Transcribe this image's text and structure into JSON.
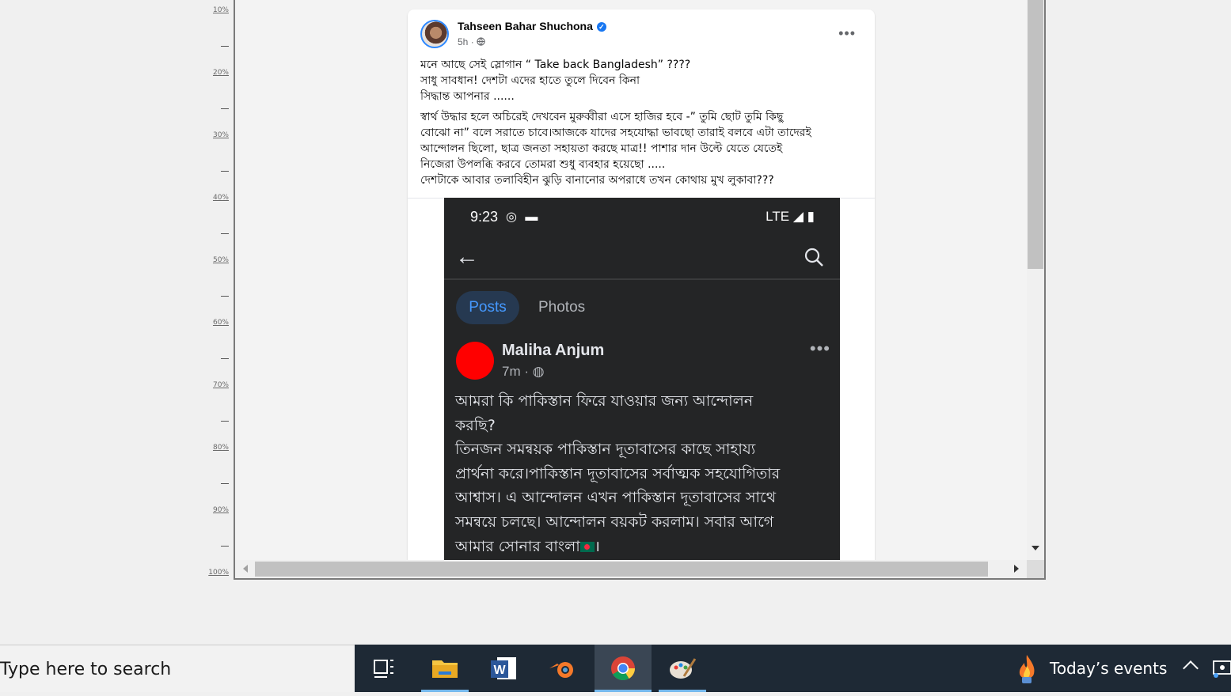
{
  "ruler": {
    "labels": [
      "10%",
      "20%",
      "30%",
      "40%",
      "50%",
      "60%",
      "70%",
      "80%",
      "90%",
      "100%"
    ]
  },
  "post": {
    "author": "Tahseen Bahar Shuchona",
    "time": "5h",
    "more_icon": "more-horizontal-icon",
    "paragraph1": [
      "মনে আছে সেই স্লোগান “ Take back Bangladesh” ????",
      "সাধু সাবধান! দেশটা এদের হাতে তুলে দিবেন কিনা",
      "সিদ্ধান্ত আপনার ......"
    ],
    "paragraph2": [
      "স্বার্থ উদ্ধার হলে অচিরেই দেখবেন মুরুব্বীরা এসে হাজির হবে -” তুমি ছোট তুমি কিছু",
      "বোঝো না” বলে সরাতে চাবে।আজকে যাদের সহযোদ্ধা ভাবছো তারাই বলবে এটা তাদেরই",
      "আন্দোলন ছিলো, ছাত্র জনতা সহায়তা করছে মাত্র!! পাশার দান উল্টে যেতে যেতেই",
      "নিজেরা উপলব্ধি করবে তোমরা শুধু ব্যবহার হয়েছো .....",
      "দেশটাকে আবার তলাবিহীন ঝুড়ি বানানোর অপরাধে তখন কোথায় মুখ লুকাবা???"
    ]
  },
  "screenshot": {
    "status_time": "9:23",
    "status_network": "LTE",
    "tabs": {
      "posts": "Posts",
      "photos": "Photos"
    },
    "inner_post": {
      "author": "Maliha Anjum",
      "time": "7m",
      "lines": [
        "আমরা কি পাকিস্তান ফিরে যাওয়ার জন্য আন্দোলন",
        "করছি?",
        "তিনজন সমন্বয়ক পাকিস্তান দূতাবাসের কাছে সাহায্য",
        "প্রার্থনা করে।পাকিস্তান দূতাবাসের সর্বাত্মক সহযোগিতার",
        "আশ্বাস। এ আন্দোলন এখন পাকিস্তান দূতাবাসের সাথে",
        "সমন্বয়ে চলছে। আন্দোলন বয়কট করলাম। সবার আগে",
        "আমার সোনার বাংলা"
      ]
    }
  },
  "taskbar": {
    "search_placeholder": "Type here to search",
    "apps": [
      "task-view",
      "file-explorer",
      "word",
      "blender",
      "chrome",
      "paint"
    ],
    "active_apps": [
      "file-explorer",
      "chrome",
      "paint"
    ],
    "events_label": "Today’s events"
  },
  "colors": {
    "facebook_blue": "#1877f2",
    "dark_bg": "#242526",
    "taskbar_bg": "#1e2935",
    "active_indicator": "#76b9ed"
  }
}
